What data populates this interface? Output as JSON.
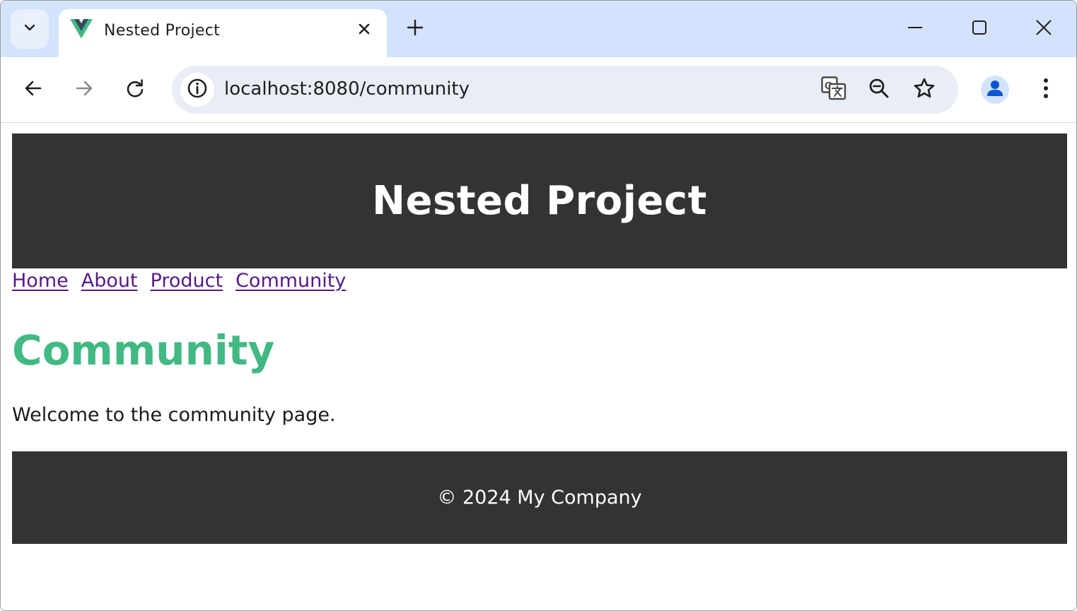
{
  "browser": {
    "tab": {
      "title": "Nested Project",
      "favicon": "vue-logo-icon"
    },
    "address_bar": {
      "url": "localhost:8080/community"
    },
    "colors": {
      "tabstrip": "#d3e3fd",
      "omnibox": "#e9eef6",
      "avatar_bg": "#d3e3fd",
      "avatar_fg": "#0b57d0"
    },
    "icons": {
      "tab_search": "chevron-down-icon",
      "tab_close": "close-icon",
      "new_tab": "plus-icon",
      "minimize": "minimize-icon",
      "maximize": "maximize-icon",
      "close_window": "close-icon",
      "back": "arrow-left-icon",
      "forward": "arrow-right-icon",
      "reload": "reload-icon",
      "site_info": "info-icon",
      "translate": "translate-icon",
      "zoom": "zoom-out-icon",
      "bookmark": "star-icon",
      "profile": "person-icon",
      "menu": "kebab-menu-icon"
    }
  },
  "page": {
    "header": {
      "title": "Nested Project"
    },
    "nav": {
      "links": [
        {
          "label": "Home"
        },
        {
          "label": "About"
        },
        {
          "label": "Product"
        },
        {
          "label": "Community"
        }
      ]
    },
    "main": {
      "heading": "Community",
      "text": "Welcome to the community page."
    },
    "footer": {
      "text": "© 2024 My Company"
    },
    "colors": {
      "header_bg": "#333333",
      "footer_bg": "#333333",
      "heading": "#42b983",
      "link": "#551a8b"
    }
  }
}
